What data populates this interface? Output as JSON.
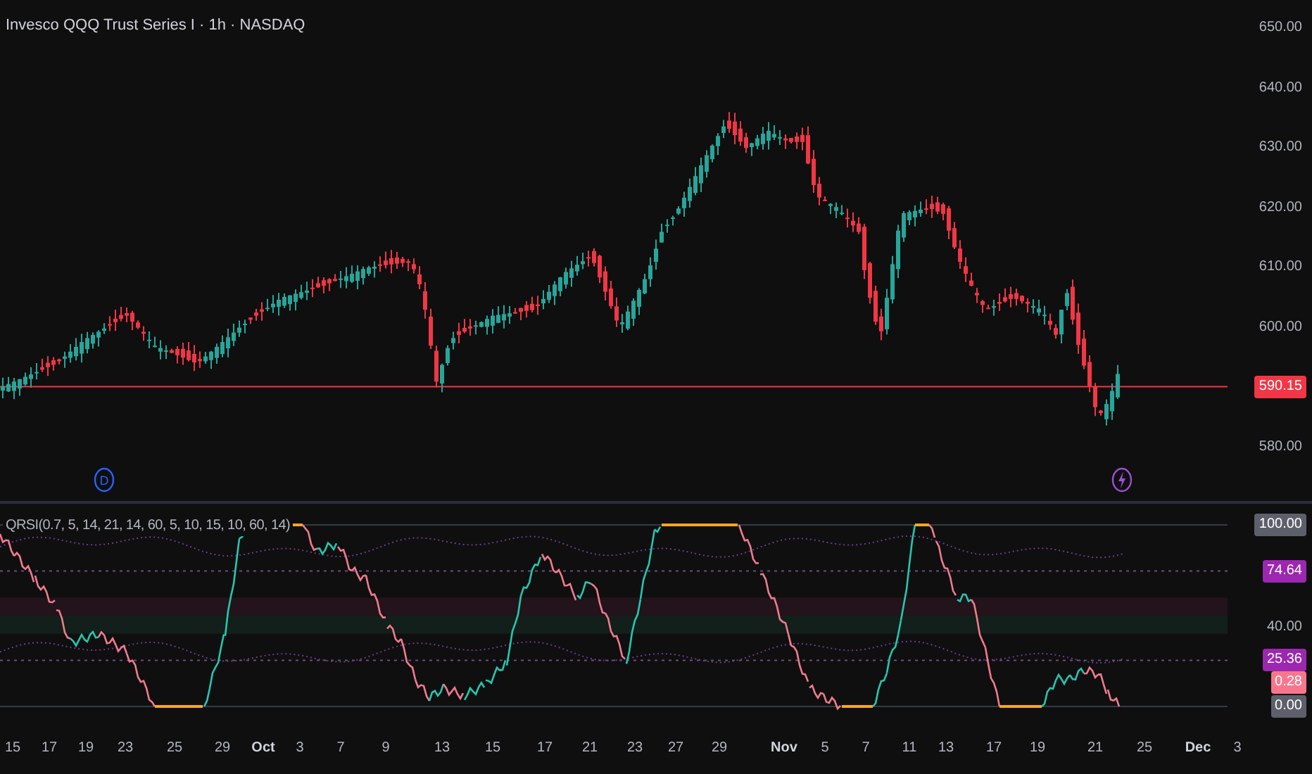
{
  "title": "Invesco QQQ Trust Series I · 1h · NASDAQ",
  "price_axis": {
    "labels": [
      "650.00",
      "640.00",
      "630.00",
      "620.00",
      "610.00",
      "600.00",
      "580.00"
    ],
    "last_price": "590.15"
  },
  "events": [
    {
      "kind": "dividend",
      "label": "D"
    },
    {
      "kind": "earnings"
    }
  ],
  "indicator": {
    "legend": "QRSI(0.7, 5, 14, 21, 14, 60, 5, 10, 15, 10, 60, 14)",
    "axis_labels": [
      {
        "text": "100.00",
        "kind": "bound"
      },
      {
        "text": "74.64",
        "kind": "band"
      },
      {
        "text": "40.00",
        "kind": "plain"
      },
      {
        "text": "25.36",
        "kind": "band"
      },
      {
        "text": "0.28",
        "kind": "value"
      },
      {
        "text": "0.00",
        "kind": "bound"
      }
    ]
  },
  "time_axis": [
    {
      "text": "15",
      "month": false
    },
    {
      "text": "17",
      "month": false
    },
    {
      "text": "19",
      "month": false
    },
    {
      "text": "23",
      "month": false
    },
    {
      "text": "25",
      "month": false
    },
    {
      "text": "29",
      "month": false
    },
    {
      "text": "Oct",
      "month": true
    },
    {
      "text": "3",
      "month": false
    },
    {
      "text": "7",
      "month": false
    },
    {
      "text": "9",
      "month": false
    },
    {
      "text": "13",
      "month": false
    },
    {
      "text": "15",
      "month": false
    },
    {
      "text": "17",
      "month": false
    },
    {
      "text": "21",
      "month": false
    },
    {
      "text": "23",
      "month": false
    },
    {
      "text": "27",
      "month": false
    },
    {
      "text": "29",
      "month": false
    },
    {
      "text": "Nov",
      "month": true
    },
    {
      "text": "5",
      "month": false
    },
    {
      "text": "7",
      "month": false
    },
    {
      "text": "11",
      "month": false
    },
    {
      "text": "13",
      "month": false
    },
    {
      "text": "17",
      "month": false
    },
    {
      "text": "19",
      "month": false
    },
    {
      "text": "21",
      "month": false
    },
    {
      "text": "25",
      "month": false
    },
    {
      "text": "Dec",
      "month": true
    },
    {
      "text": "3",
      "month": false
    }
  ]
}
